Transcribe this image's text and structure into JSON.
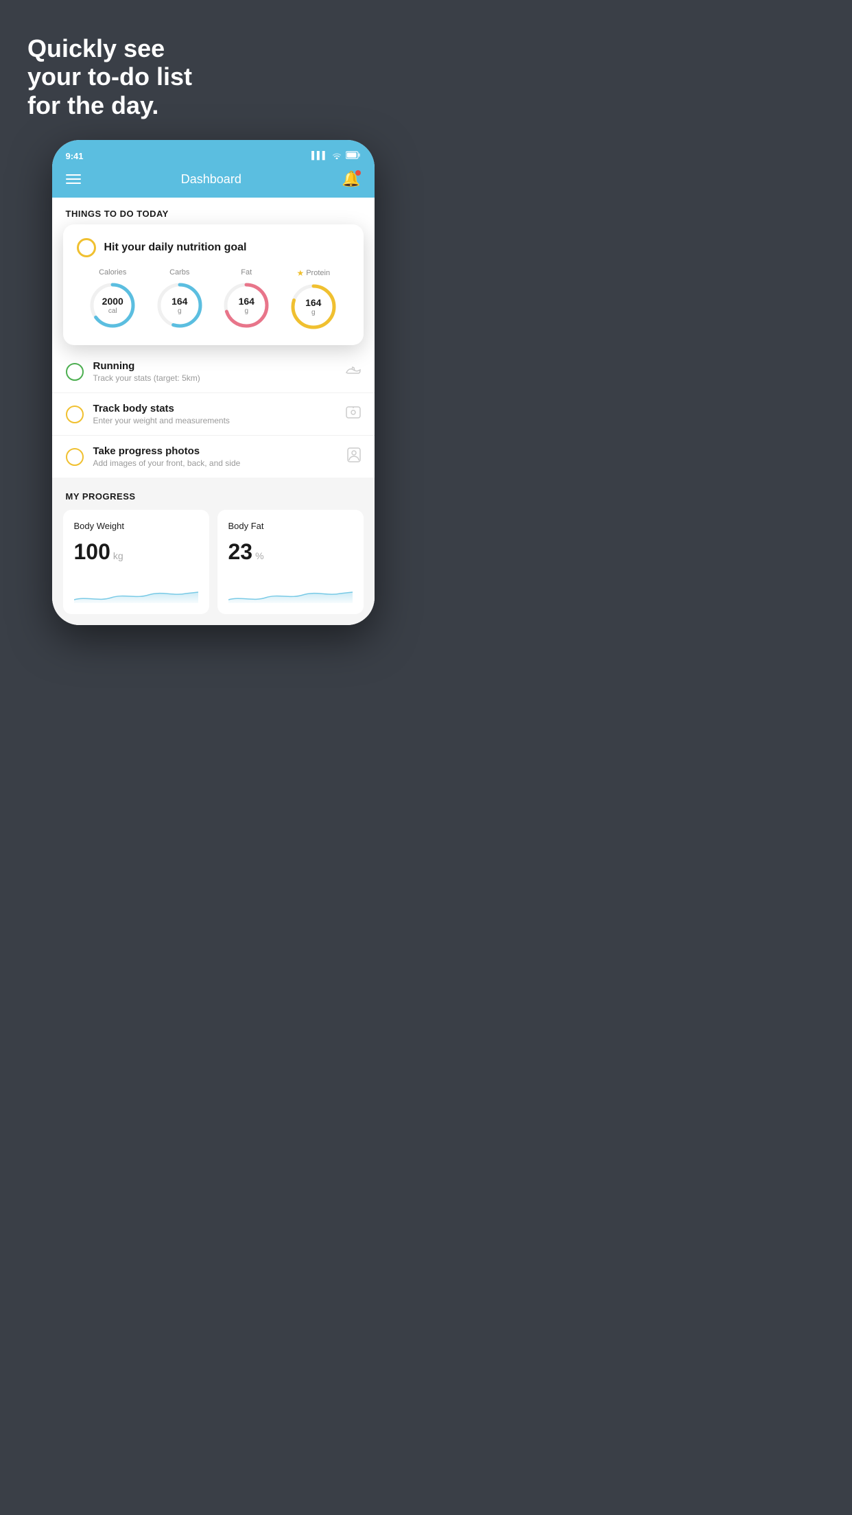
{
  "page": {
    "background_color": "#3a3f47",
    "headline": "Quickly see\nyour to-do list\nfor the day."
  },
  "status_bar": {
    "time": "9:41",
    "signal_icon": "signal-icon",
    "wifi_icon": "wifi-icon",
    "battery_icon": "battery-icon"
  },
  "nav": {
    "title": "Dashboard",
    "menu_label": "menu",
    "bell_label": "notifications"
  },
  "things_today": {
    "section_title": "THINGS TO DO TODAY"
  },
  "nutrition_card": {
    "label": "Hit your daily nutrition goal",
    "items": [
      {
        "name": "Calories",
        "value": "2000",
        "unit": "cal",
        "color": "#5bbee0",
        "percent": 65
      },
      {
        "name": "Carbs",
        "value": "164",
        "unit": "g",
        "color": "#5bbee0",
        "percent": 55
      },
      {
        "name": "Fat",
        "value": "164",
        "unit": "g",
        "color": "#e8758a",
        "percent": 70
      },
      {
        "name": "Protein",
        "value": "164",
        "unit": "g",
        "color": "#f0c030",
        "percent": 80,
        "starred": true
      }
    ]
  },
  "todo_items": [
    {
      "label": "Running",
      "sublabel": "Track your stats (target: 5km)",
      "icon": "shoe-icon",
      "status": "green"
    },
    {
      "label": "Track body stats",
      "sublabel": "Enter your weight and measurements",
      "icon": "scale-icon",
      "status": "yellow"
    },
    {
      "label": "Take progress photos",
      "sublabel": "Add images of your front, back, and side",
      "icon": "portrait-icon",
      "status": "yellow"
    }
  ],
  "progress": {
    "section_title": "MY PROGRESS",
    "cards": [
      {
        "title": "Body Weight",
        "value": "100",
        "unit": "kg"
      },
      {
        "title": "Body Fat",
        "value": "23",
        "unit": "%"
      }
    ]
  }
}
